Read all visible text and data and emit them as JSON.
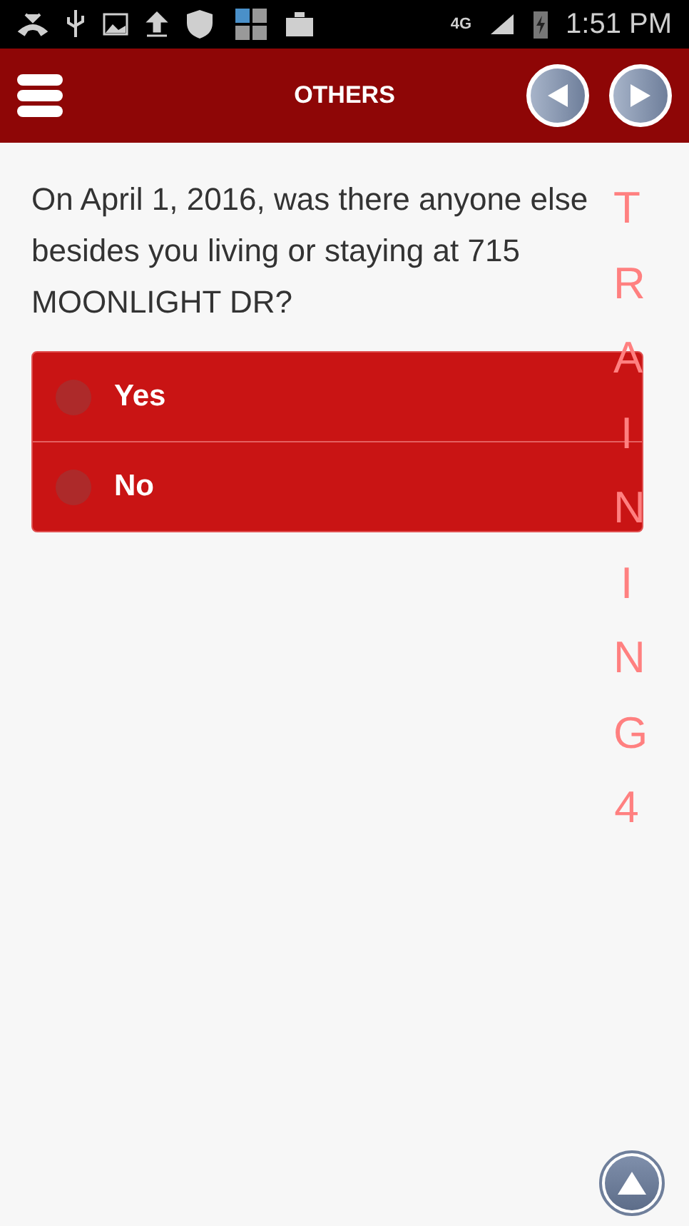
{
  "status_bar": {
    "network": "4G",
    "time": "1:51 PM"
  },
  "header": {
    "title": "OTHERS"
  },
  "question": "On April 1, 2016, was there anyone else besides you living or staying at 715 MOONLIGHT DR?",
  "options": [
    {
      "label": "Yes",
      "selected": false
    },
    {
      "label": "No",
      "selected": false
    }
  ],
  "overlay": "TRAINING4"
}
